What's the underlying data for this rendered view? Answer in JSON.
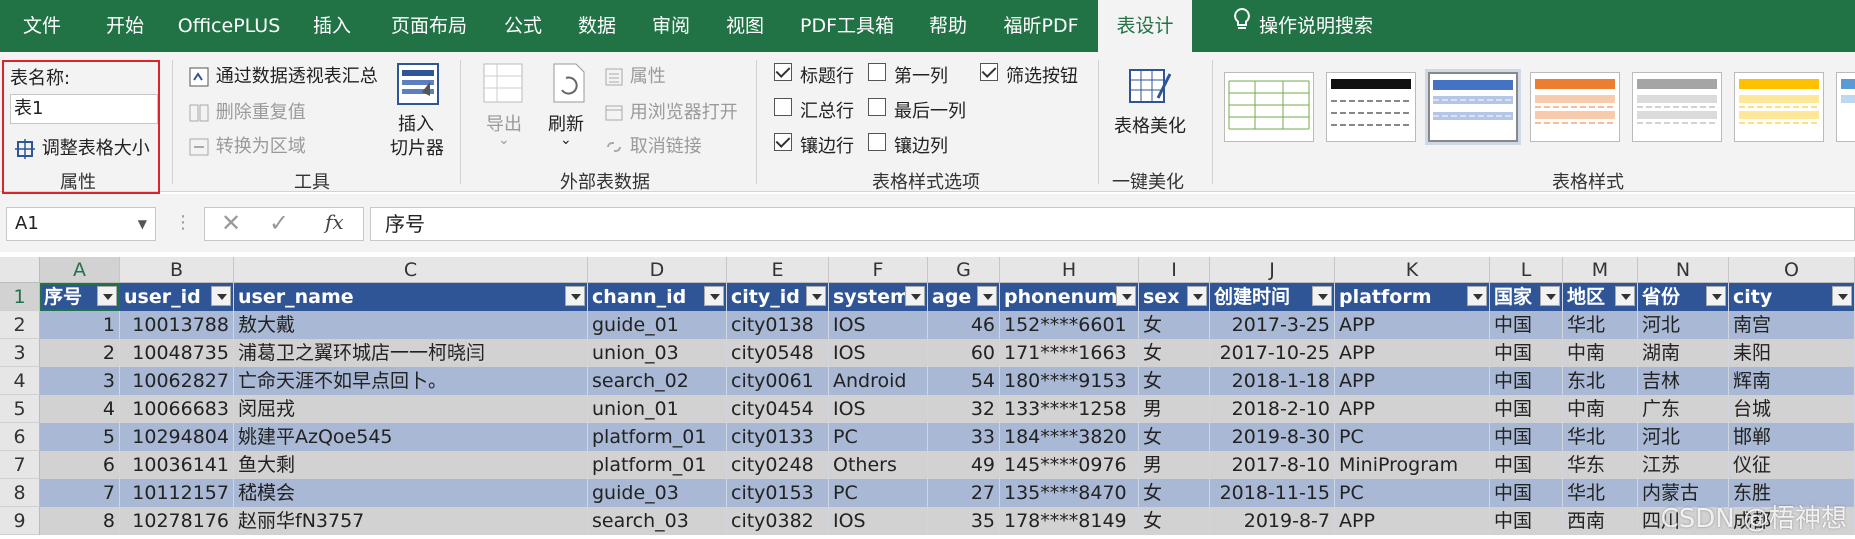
{
  "tabs": [
    "文件",
    "开始",
    "OfficePLUS",
    "插入",
    "页面布局",
    "公式",
    "数据",
    "审阅",
    "视图",
    "PDF工具箱",
    "帮助",
    "福昕PDF",
    "表设计",
    "操作说明搜索"
  ],
  "ribbon": {
    "properties": {
      "label": "表名称:",
      "table_name": "表1",
      "resize": "调整表格大小",
      "group": "属性"
    },
    "tools": {
      "pivot": "通过数据透视表汇总",
      "remove_dup": "删除重复值",
      "convert": "转换为区域",
      "slicer_line1": "插入",
      "slicer_line2": "切片器",
      "group": "工具"
    },
    "external": {
      "export": "导出",
      "refresh": "刷新",
      "props": "属性",
      "open_browser": "用浏览器打开",
      "unlink": "取消链接",
      "group": "外部表数据"
    },
    "style_options": {
      "header_row": "标题行",
      "first_col": "第一列",
      "filter_btn": "筛选按钮",
      "total_row": "汇总行",
      "last_col": "最后一列",
      "banded_rows": "镶边行",
      "banded_cols": "镶边列",
      "group": "表格样式选项"
    },
    "beautify": {
      "label": "表格美化",
      "group": "一键美化"
    },
    "styles": {
      "group": "表格样式"
    }
  },
  "formula_bar": {
    "name_box": "A1",
    "content": "序号",
    "fx": "fx"
  },
  "columns": [
    "A",
    "B",
    "C",
    "D",
    "E",
    "F",
    "G",
    "H",
    "I",
    "J",
    "K",
    "L",
    "M",
    "N",
    "O"
  ],
  "headers": [
    "序号",
    "user_id",
    "user_name",
    "chann_id",
    "city_id",
    "system",
    "age",
    "phonenum",
    "sex",
    "创建时间",
    "platform",
    "国家",
    "地区",
    "省份",
    "city"
  ],
  "rows": [
    [
      "1",
      "10013788",
      "敖大戴",
      "guide_01",
      "city0138",
      "IOS",
      "46",
      "152****6601",
      "女",
      "2017-3-25",
      "APP",
      "中国",
      "华北",
      "河北",
      "南宫"
    ],
    [
      "2",
      "10048735",
      "浦葛卫之翼环城店一一柯晓闫",
      "union_03",
      "city0548",
      "IOS",
      "60",
      "171****1663",
      "女",
      "2017-10-25",
      "APP",
      "中国",
      "中南",
      "湖南",
      "耒阳"
    ],
    [
      "3",
      "10062827",
      "亡命天涯不如早点回卜。",
      "search_02",
      "city0061",
      "Android",
      "54",
      "180****9153",
      "女",
      "2018-1-18",
      "APP",
      "中国",
      "东北",
      "吉林",
      "辉南"
    ],
    [
      "4",
      "10066683",
      "闵屈戎",
      "union_01",
      "city0454",
      "IOS",
      "32",
      "133****1258",
      "男",
      "2018-2-10",
      "APP",
      "中国",
      "中南",
      "广东",
      "台城"
    ],
    [
      "5",
      "10294804",
      "姚建平AzQoe545",
      "platform_01",
      "city0133",
      "PC",
      "33",
      "184****3820",
      "女",
      "2019-8-30",
      "PC",
      "中国",
      "华北",
      "河北",
      "邯郸"
    ],
    [
      "6",
      "10036141",
      "鱼大剩",
      "platform_01",
      "city0248",
      "Others",
      "49",
      "145****0976",
      "男",
      "2017-8-10",
      "MiniProgram",
      "中国",
      "华东",
      "江苏",
      "仪征"
    ],
    [
      "7",
      "10112157",
      "嵇模会",
      "guide_03",
      "city0153",
      "PC",
      "27",
      "135****8470",
      "女",
      "2018-11-15",
      "PC",
      "中国",
      "华北",
      "内蒙古",
      "东胜"
    ],
    [
      "8",
      "10278176",
      "赵丽华fN3757",
      "search_03",
      "city0382",
      "IOS",
      "35",
      "178****8149",
      "女",
      "2019-8-7",
      "APP",
      "中国",
      "西南",
      "四川",
      "成都"
    ]
  ],
  "row_numbers": [
    "1",
    "2",
    "3",
    "4",
    "5",
    "6",
    "7",
    "8",
    "9"
  ],
  "watermark": "CSDN @梧神想"
}
